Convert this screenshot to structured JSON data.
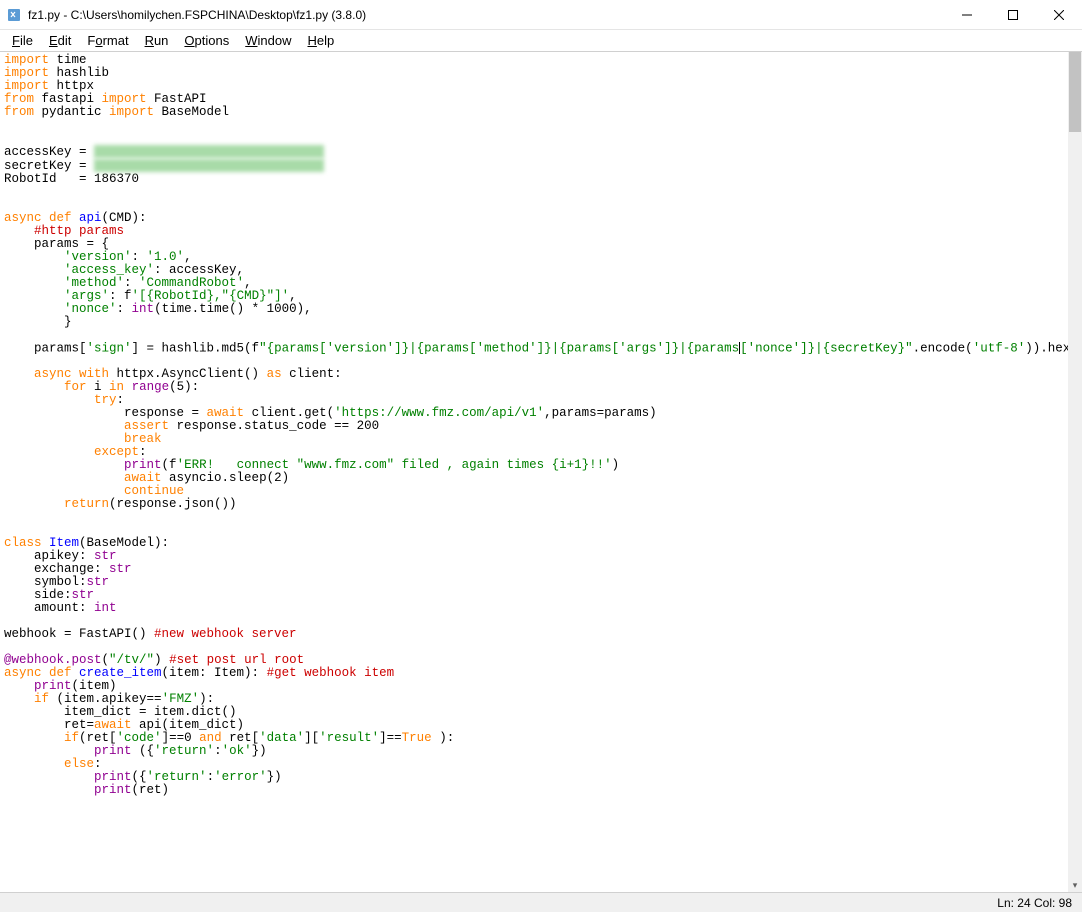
{
  "titlebar": {
    "title": "fz1.py - C:\\Users\\homilychen.FSPCHINA\\Desktop\\fz1.py (3.8.0)"
  },
  "menubar": {
    "items": [
      "File",
      "Edit",
      "Format",
      "Run",
      "Options",
      "Window",
      "Help"
    ],
    "underlines": [
      "F",
      "E",
      "o",
      "R",
      "O",
      "W",
      "H"
    ]
  },
  "code": {
    "l1a": "import",
    "l1b": " time",
    "l2a": "import",
    "l2b": " hashlib",
    "l3a": "import",
    "l3b": " httpx",
    "l4a": "from",
    "l4b": " fastapi ",
    "l4c": "import",
    "l4d": " FastAPI",
    "l5a": "from",
    "l5b": " pydantic ",
    "l5c": "import",
    "l5d": " BaseModel",
    "l7a": "accessKey = ",
    "l8a": "secretKey = ",
    "l9a": "RobotId   = 186370",
    "l11a": "async def ",
    "l11b": "api",
    "l11c": "(CMD):",
    "l12a": "    ",
    "l12b": "#http params",
    "l13a": "    params = {",
    "l14a": "        ",
    "l14b": "'version'",
    "l14c": ": ",
    "l14d": "'1.0'",
    "l14e": ",",
    "l15a": "        ",
    "l15b": "'access_key'",
    "l15c": ": accessKey,",
    "l16a": "        ",
    "l16b": "'method'",
    "l16c": ": ",
    "l16d": "'CommandRobot'",
    "l16e": ",",
    "l17a": "        ",
    "l17b": "'args'",
    "l17c": ": f",
    "l17d": "'[{RobotId},\"{CMD}\"]'",
    "l17e": ",",
    "l18a": "        ",
    "l18b": "'nonce'",
    "l18c": ": ",
    "l18d": "int",
    "l18e": "(time.time() * 1000),",
    "l19a": "        }",
    "l21a": "    params[",
    "l21b": "'sign'",
    "l21c": "] = hashlib.md5(f",
    "l21d": "\"{params['version']}|{params['method']}|{params['args']}|{params",
    "l21dd": "['nonce']}|{secretKey}\"",
    "l21e": ".encode(",
    "l21f": "'utf-8'",
    "l21g": ")).hexdigest()",
    "l23a": "    ",
    "l23b": "async with",
    "l23c": " httpx.AsyncClient() ",
    "l23d": "as",
    "l23e": " client:",
    "l24a": "        ",
    "l24b": "for",
    "l24c": " i ",
    "l24d": "in",
    "l24e": " ",
    "l24f": "range",
    "l24g": "(5):",
    "l25a": "            ",
    "l25b": "try",
    "l25c": ":",
    "l26a": "                response = ",
    "l26b": "await",
    "l26c": " client.get(",
    "l26d": "'https://www.fmz.com/api/v1'",
    "l26e": ",params=params)",
    "l27a": "                ",
    "l27b": "assert",
    "l27c": " response.status_code == 200",
    "l28a": "                ",
    "l28b": "break",
    "l29a": "            ",
    "l29b": "except",
    "l29c": ":",
    "l30a": "                ",
    "l30b": "print",
    "l30c": "(f",
    "l30d": "'ERR!   connect \"www.fmz.com\" filed , again times {i+1}!!'",
    "l30e": ")",
    "l31a": "                ",
    "l31b": "await",
    "l31c": " asyncio.sleep(2)",
    "l32a": "                ",
    "l32b": "continue",
    "l33a": "        ",
    "l33b": "return",
    "l33c": "(response.json())",
    "l36a": "class ",
    "l36b": "Item",
    "l36c": "(BaseModel):",
    "l37a": "    apikey: ",
    "l37b": "str",
    "l38a": "    exchange: ",
    "l38b": "str",
    "l39a": "    symbol:",
    "l39b": "str",
    "l40a": "    side:",
    "l40b": "str",
    "l41a": "    amount: ",
    "l41b": "int",
    "l43a": "webhook = FastAPI() ",
    "l43b": "#new webhook server",
    "l45a": "@webhook.post",
    "l45b": "(",
    "l45c": "\"/tv/\"",
    "l45d": ") ",
    "l45e": "#set post url root",
    "l46a": "async def ",
    "l46b": "create_item",
    "l46c": "(item: Item): ",
    "l46d": "#get webhook item",
    "l47a": "    ",
    "l47b": "print",
    "l47c": "(item)",
    "l48a": "    ",
    "l48b": "if",
    "l48c": " (item.apikey==",
    "l48d": "'FMZ'",
    "l48e": "):",
    "l49a": "        item_dict = item.dict()",
    "l50a": "        ret=",
    "l50b": "await",
    "l50c": " api(item_dict)",
    "l51a": "        ",
    "l51b": "if",
    "l51c": "(ret[",
    "l51d": "'code'",
    "l51e": "]==0 ",
    "l51f": "and",
    "l51g": " ret[",
    "l51h": "'data'",
    "l51i": "][",
    "l51j": "'result'",
    "l51k": "]==",
    "l51l": "True",
    "l51m": " ):",
    "l52a": "            ",
    "l52b": "print",
    "l52c": " ({",
    "l52d": "'return'",
    "l52e": ":",
    "l52f": "'ok'",
    "l52g": "})",
    "l53a": "        ",
    "l53b": "else",
    "l53c": ":",
    "l54a": "            ",
    "l54b": "print",
    "l54c": "({",
    "l54d": "'return'",
    "l54e": ":",
    "l54f": "'error'",
    "l54g": "})",
    "l55a": "            ",
    "l55b": "print",
    "l55c": "(ret)"
  },
  "statusbar": {
    "text": "Ln: 24  Col: 98"
  }
}
